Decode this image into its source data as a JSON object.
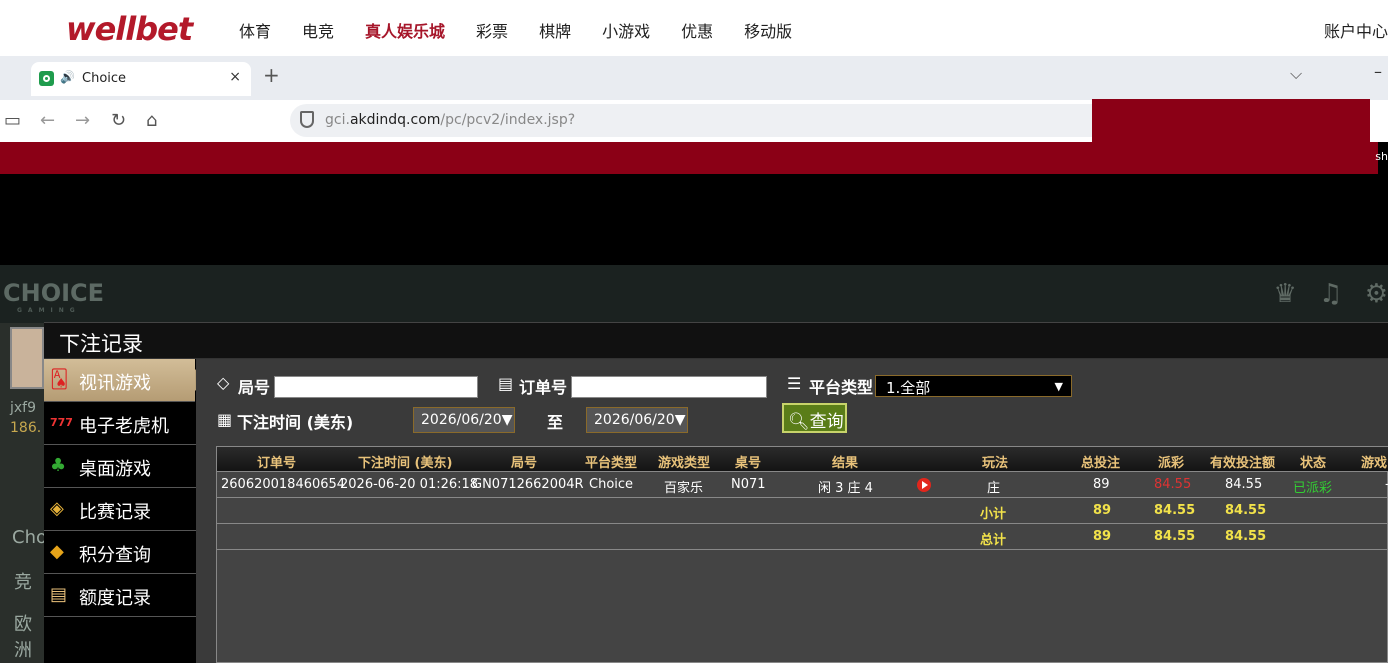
{
  "site": {
    "logo": "wellbet",
    "nav": [
      "体育",
      "电竞",
      "真人娱乐城",
      "彩票",
      "棋牌",
      "小游戏",
      "优惠",
      "移动版"
    ],
    "active_nav": "真人娱乐城",
    "account": "账户中心"
  },
  "browser": {
    "tab_title": "Choice",
    "tab_close": "×",
    "new_tab": "+",
    "url_host": "gci.akdindq.com",
    "url_path": "/pc/pcv2/index.jsp?",
    "url_prefix": "gci.",
    "url_domain": "akdindq.com",
    "strip_text": "sh"
  },
  "game": {
    "brand": "CHOICE",
    "brand_sub": "GAMING",
    "left_user": "jxf9",
    "left_amount": "186.",
    "left_labels": [
      "Cho",
      "竞",
      "欧洲"
    ]
  },
  "dialog": {
    "title": "下注记录",
    "menu": [
      {
        "label": "视讯游戏",
        "icon": "🂡",
        "active": true
      },
      {
        "label": "电子老虎机",
        "icon": "777",
        "active": false
      },
      {
        "label": "桌面游戏",
        "icon": "♣",
        "active": false
      },
      {
        "label": "比赛记录",
        "icon": "◈",
        "active": false
      },
      {
        "label": "积分查询",
        "icon": "◆",
        "active": false
      },
      {
        "label": "额度记录",
        "icon": "▤",
        "active": false
      }
    ],
    "filters": {
      "round_label": "局号",
      "order_label": "订单号",
      "platform_label": "平台类型",
      "platform_value": "1.全部",
      "time_label": "下注时间 (美东)",
      "date_from": "2026/06/20▼",
      "to_label": "至",
      "date_to": "2026/06/20▼",
      "query": "查询"
    },
    "table": {
      "headers": [
        "订单号",
        "下注时间 (美东)",
        "局号",
        "平台类型",
        "游戏类型",
        "桌号",
        "结果",
        "玩法",
        "总投注",
        "派彩",
        "有效投注额",
        "状态",
        "游戏"
      ],
      "rows": [
        {
          "order": "260620018460654",
          "time": "2026-06-20 01:26:18",
          "round": "GN0712662004R",
          "platform": "Choice",
          "game_type": "百家乐",
          "table": "N071",
          "result": "闲 3 庄 4",
          "bet": "庄",
          "total": "89",
          "payout": "84.55",
          "valid": "84.55",
          "status": "已派彩",
          "game": "-"
        }
      ],
      "subtotal": {
        "label": "小计",
        "total": "89",
        "payout": "84.55",
        "valid": "84.55"
      },
      "grandtotal": {
        "label": "总计",
        "total": "89",
        "payout": "84.55",
        "valid": "84.55"
      }
    }
  },
  "colors": {
    "brand": "#b3192a",
    "dark_red": "#8b0016",
    "header_gold": "#e8c27a",
    "sum_yellow": "#f2e24a"
  }
}
